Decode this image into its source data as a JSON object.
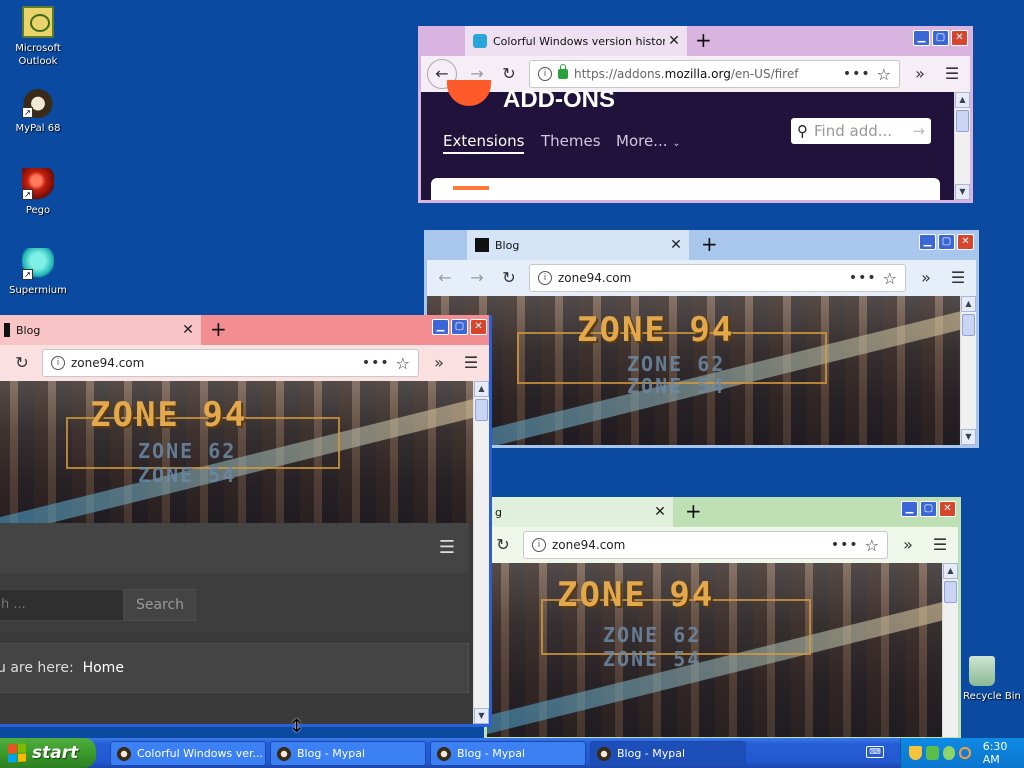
{
  "desktop": {
    "icons": [
      {
        "label": "Microsoft Outlook"
      },
      {
        "label": "MyPal 68"
      },
      {
        "label": "Pego"
      },
      {
        "label": "Supermium"
      },
      {
        "label": "Recycle Bin"
      }
    ]
  },
  "window_addons": {
    "tab_title": "Colorful Windows version history",
    "url_prefix": "https://addons.",
    "url_domain": "mozilla.org",
    "url_suffix": "/en-US/firef",
    "brand": "ADD-ONS",
    "nav": [
      "Extensions",
      "Themes",
      "More..."
    ],
    "search_placeholder": "Find add..."
  },
  "window_blog1": {
    "tab_title": "Blog",
    "url": "zone94.com",
    "banner_title": "ZONE 94",
    "banner_sub1": "ZONE 62",
    "banner_sub2": "ZONE 54"
  },
  "window_blog2": {
    "tab_title": "Blog",
    "url": "zone94.com",
    "banner_title": "ZONE 94",
    "banner_sub1": "ZONE 62",
    "banner_sub2": "ZONE 54",
    "search_button": "Search",
    "search_placeholder": "h ...",
    "breadcrumb_prefix": "u are here:",
    "breadcrumb_home": "Home"
  },
  "window_blog3": {
    "tab_title": "g",
    "url": "zone94.com",
    "banner_title": "ZONE 94",
    "banner_sub1": "ZONE 62",
    "banner_sub2": "ZONE 54"
  },
  "taskbar": {
    "start_label": "start",
    "tasks": [
      {
        "label": "Colorful Windows ver..."
      },
      {
        "label": "Blog - Mypal"
      },
      {
        "label": "Blog - Mypal"
      },
      {
        "label": "Blog - Mypal"
      }
    ],
    "clock": "6:30 AM"
  },
  "colors": {
    "desktop_bg": "#0a4aa0",
    "addons_frame": "#d9b4e0",
    "blog1_frame": "#a9c6ec",
    "blog2_frame": "#f28e92",
    "blog3_frame": "#bfe0b5"
  }
}
